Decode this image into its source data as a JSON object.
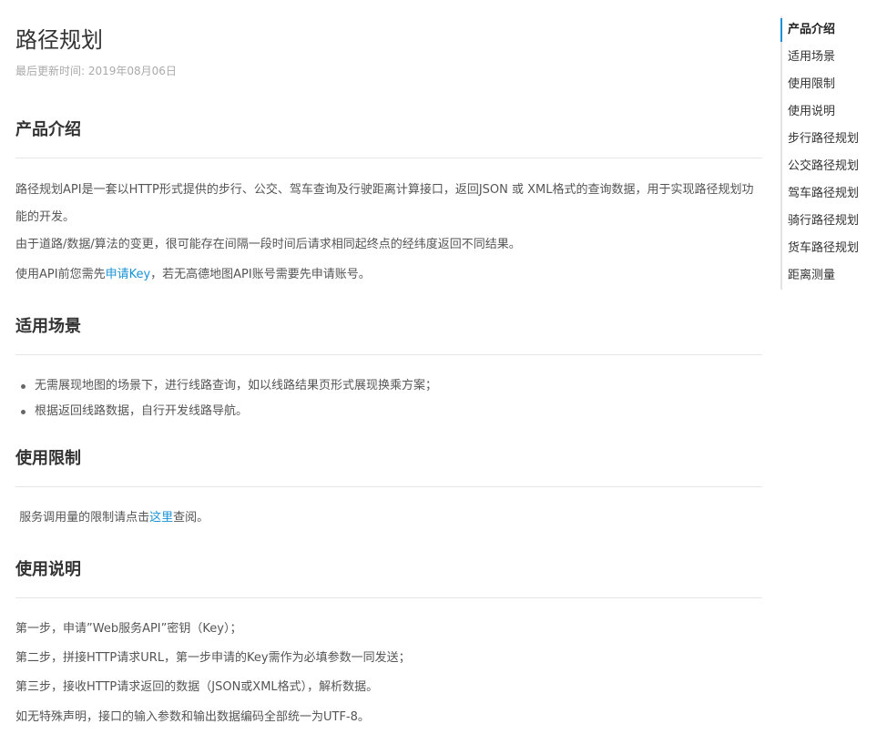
{
  "page": {
    "title": "路径规划",
    "updated": "最后更新时间: 2019年08月06日"
  },
  "sections": {
    "intro": {
      "title": "产品介绍",
      "p1": "路径规划API是一套以HTTP形式提供的步行、公交、驾车查询及行驶距离计算接口，返回JSON 或 XML格式的查询数据，用于实现路径规划功能的开发。",
      "p2": "由于道路/数据/算法的变更，很可能存在间隔一段时间后请求相同起终点的经纬度返回不同结果。",
      "p3_before": "使用API前您需先",
      "p3_link": "申请Key",
      "p3_after": "，若无高德地图API账号需要先申请账号。"
    },
    "scenarios": {
      "title": "适用场景",
      "items": [
        "无需展现地图的场景下，进行线路查询，如以线路结果页形式展现换乘方案；",
        "根据返回线路数据，自行开发线路导航。"
      ]
    },
    "limits": {
      "title": "使用限制",
      "text_before": " 服务调用量的限制请点击",
      "link": "这里",
      "text_after": "查阅。"
    },
    "usage": {
      "title": "使用说明",
      "steps": [
        "第一步，申请”Web服务API”密钥（Key）；",
        "第二步，拼接HTTP请求URL，第一步申请的Key需作为必填参数一同发送；",
        "第三步，接收HTTP请求返回的数据（JSON或XML格式），解析数据。",
        "如无特殊声明，接口的输入参数和输出数据编码全部统一为UTF-8。"
      ]
    }
  },
  "toc": {
    "items": [
      "产品介绍",
      "适用场景",
      "使用限制",
      "使用说明",
      "步行路径规划",
      "公交路径规划",
      "驾车路径规划",
      "骑行路径规划",
      "货车路径规划",
      "距离测量"
    ],
    "active_index": 0
  },
  "colors": {
    "link": "#1a93d6",
    "toc_active_bar": "#1a93d6"
  }
}
